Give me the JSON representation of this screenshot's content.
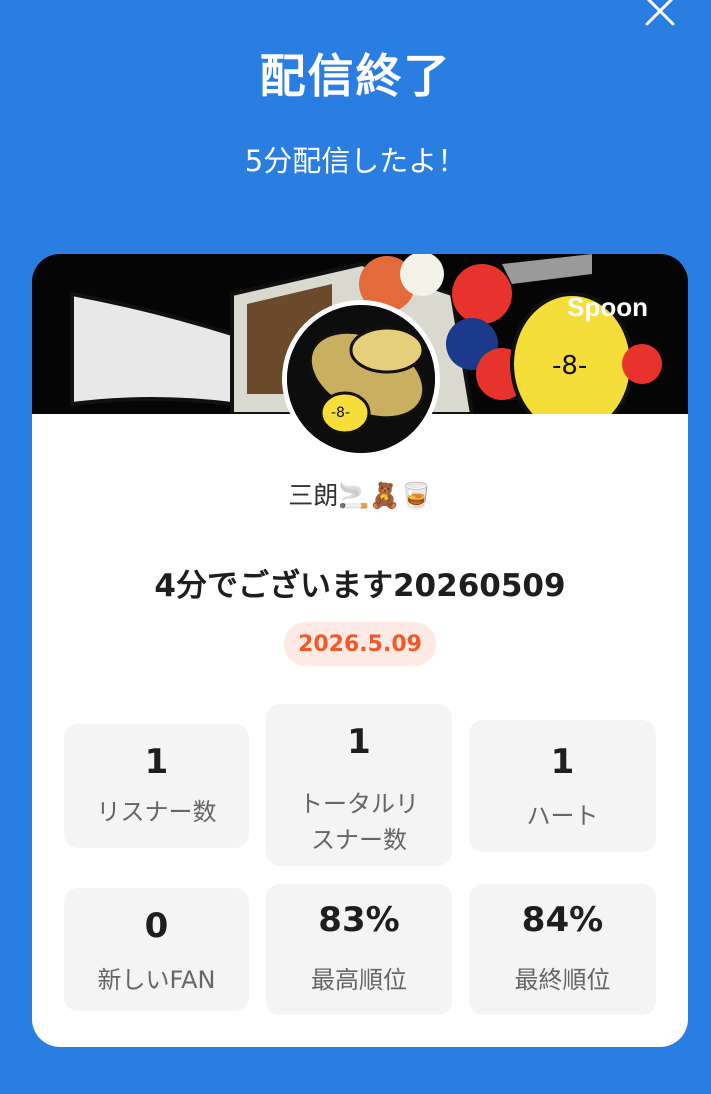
{
  "header": {
    "title": "配信終了",
    "subtitle": "5分配信したよ！"
  },
  "banner": {
    "logo_text": "Spoon"
  },
  "profile": {
    "username": "三朗🚬🧸🥃",
    "stream_title": "4分でございます20260509",
    "date": "2026.5.09"
  },
  "stats": [
    {
      "value": "1",
      "label": "リスナー数"
    },
    {
      "value": "1",
      "label": "トータルリスナー数"
    },
    {
      "value": "1",
      "label": "ハート"
    },
    {
      "value": "0",
      "label": "新しいFAN"
    },
    {
      "value": "83%",
      "label": "最高順位"
    },
    {
      "value": "84%",
      "label": "最終順位"
    }
  ],
  "colors": {
    "background": "#2a7de1",
    "card": "#ffffff",
    "date_badge_bg": "#fdeae4",
    "date_badge_text": "#f05a2a",
    "stat_bg": "#f4f4f4"
  },
  "icons": [
    "close-icon"
  ]
}
